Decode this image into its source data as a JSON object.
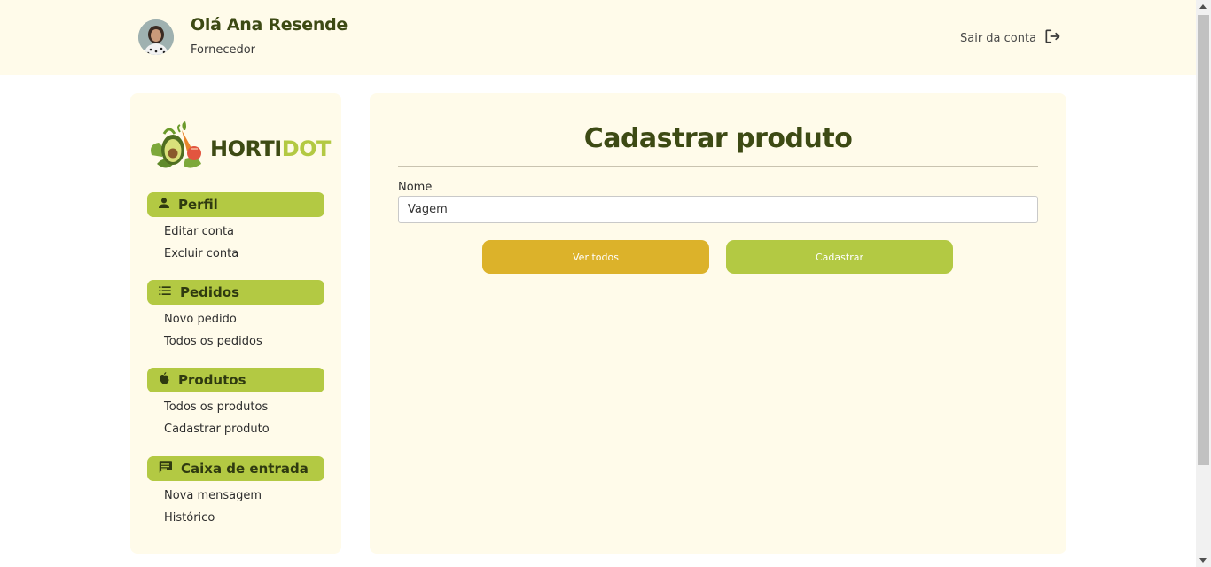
{
  "header": {
    "greeting": "Olá Ana Resende",
    "role": "Fornecedor",
    "logout_label": "Sair da conta",
    "logout_icon": "logout-icon",
    "avatar_icon": "avatar"
  },
  "sidebar": {
    "logo": {
      "text_main": "HORTI",
      "text_accent": "DOT",
      "accent_color": "#b3c943"
    },
    "sections": [
      {
        "label": "Perfil",
        "icon": "person-icon",
        "items": [
          "Editar conta",
          "Excluir conta"
        ]
      },
      {
        "label": "Pedidos",
        "icon": "list-icon",
        "items": [
          "Novo pedido",
          "Todos os pedidos"
        ]
      },
      {
        "label": "Produtos",
        "icon": "apple-icon",
        "items": [
          "Todos os produtos",
          "Cadastrar produto"
        ]
      },
      {
        "label": "Caixa de entrada",
        "icon": "message-icon",
        "items": [
          "Nova mensagem",
          "Histórico"
        ]
      }
    ]
  },
  "main": {
    "title": "Cadastrar produto",
    "field_label": "Nome",
    "field_value": "Vagem",
    "btn_view_all": "Ver todos",
    "btn_submit": "Cadastrar"
  },
  "colors": {
    "header_bg": "#fffbea",
    "primary_green": "#b3c943",
    "dark_green": "#3d4a14",
    "gold": "#dcb22a"
  }
}
